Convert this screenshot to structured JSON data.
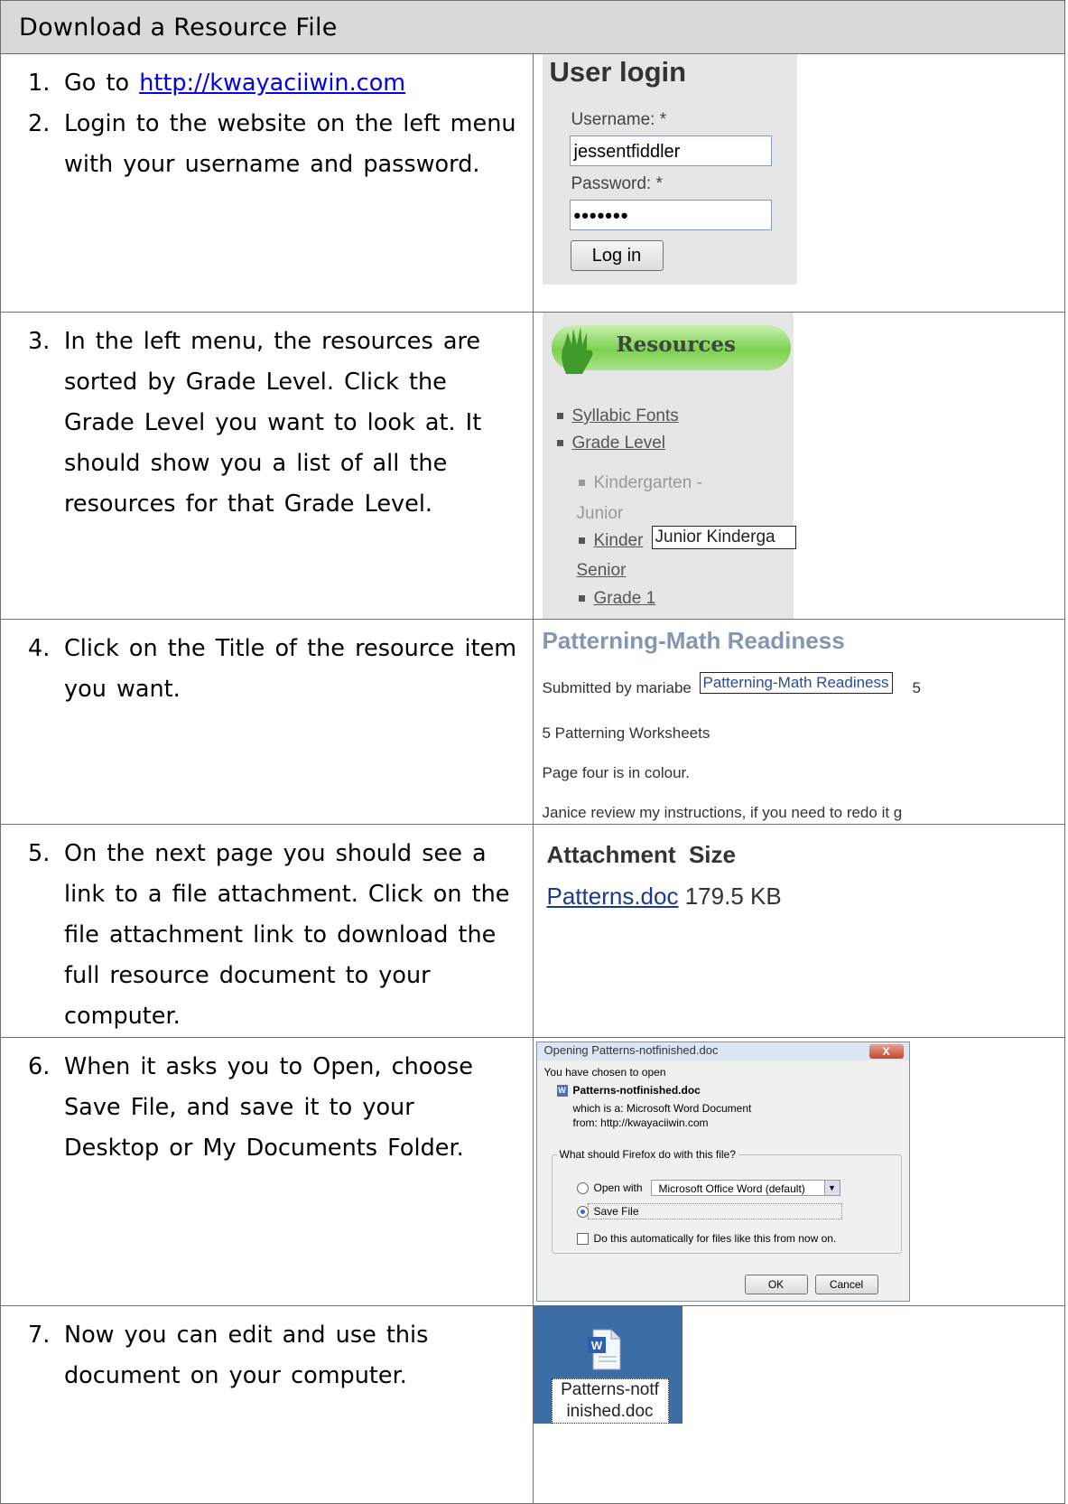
{
  "header": "Download a Resource File",
  "steps": [
    {
      "num": "1.",
      "prefix": "Go to ",
      "link": "http://kwayaciiwin.com"
    },
    {
      "num": "2.",
      "text": "Login to the website on the left menu with your username and password."
    },
    {
      "num": "3.",
      "text": "In the left menu, the resources are sorted by Grade Level.  Click the Grade Level you want to look at. It should show you a list of all the resources for that Grade Level."
    },
    {
      "num": "4.",
      "text": "Click on the Title of the resource item you want."
    },
    {
      "num": "5.",
      "text": "On the next page you should see a link to a file attachment.  Click on the file attachment link to download the full resource document to your computer."
    },
    {
      "num": "6.",
      "text": "When it asks you to Open, choose Save File, and save it to your Desktop or My Documents Folder."
    },
    {
      "num": "7.",
      "text": "Now you can edit and use this document on your computer."
    }
  ],
  "login": {
    "title": "User login",
    "username_label": "Username: *",
    "username_value": "jessentfiddler",
    "password_label": "Password: *",
    "password_value": "•••••••",
    "button": "Log in"
  },
  "resources": {
    "banner": "Resources",
    "items": [
      "Syllabic Fonts",
      "Grade Level"
    ],
    "sub_kj_1": "Kindergarten -",
    "sub_kj_2": "Junior",
    "sub_ks_1": "Kinder",
    "sub_ks_2": "Senior",
    "tooltip": "Junior Kinderga",
    "grade1": "Grade 1"
  },
  "article": {
    "title": "Patterning-Math Readiness",
    "submitted": "Submitted by mariabe",
    "tooltip": "Patterning-Math Readiness",
    "tooltip_tail": "5",
    "line1": "5 Patterning Worksheets",
    "line2": "Page four is in colour.",
    "line3": "Janice review my instructions, if you need to redo it g"
  },
  "attachment": {
    "col1": "Attachment",
    "col2": "Size",
    "file": "Patterns.doc",
    "size": "179.5 KB"
  },
  "dialog": {
    "title": "Opening Patterns-notfinished.doc",
    "close": "X",
    "chosen": "You have chosen to open",
    "filename": "Patterns-notfinished.doc",
    "which_is": "which is a:  Microsoft Word Document",
    "from": "from:  http://kwayaciiwin.com",
    "question": "What should Firefox do with this file?",
    "open_with": "Open with",
    "app": "Microsoft Office Word (default)",
    "save_file": "Save File",
    "auto": "Do this automatically for files like this from now on.",
    "ok": "OK",
    "cancel": "Cancel"
  },
  "desktop": {
    "line1": "Patterns-notf",
    "line2": "inished.doc"
  }
}
